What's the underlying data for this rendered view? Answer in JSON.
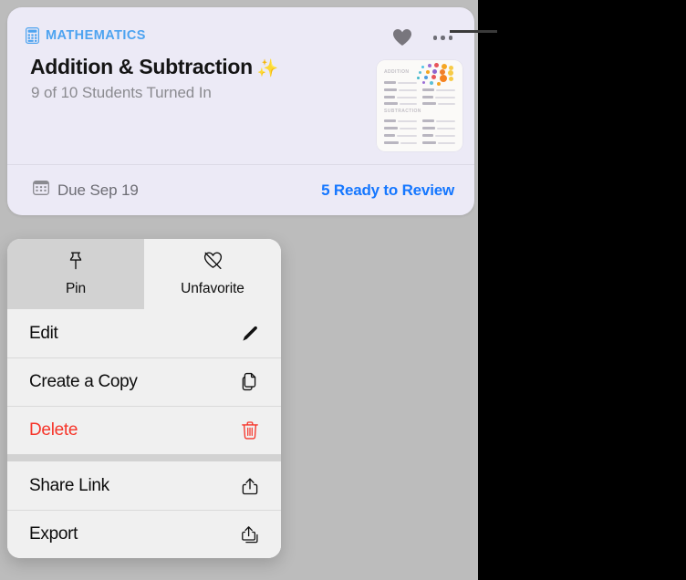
{
  "card": {
    "subject": "MATHEMATICS",
    "subject_icon": "calculator-icon",
    "title": "Addition & Subtraction",
    "title_emoji": "✨",
    "subtitle": "9 of 10 Students Turned In",
    "favorite_icon": "heart-filled-icon",
    "more_icon": "ellipsis-icon",
    "accent_color": "#4da3f0",
    "background_color": "#eceaf6",
    "footer": {
      "due_icon": "calendar-icon",
      "due_text": "Due Sep 19",
      "review_text": "5 Ready to Review",
      "review_color": "#1577ff"
    },
    "thumbnail": {
      "heading_1": "ADDITION",
      "heading_2": "SUBTRACTION"
    }
  },
  "menu": {
    "top_actions": [
      {
        "label": "Pin",
        "icon": "pin-icon",
        "selected": false
      },
      {
        "label": "Unfavorite",
        "icon": "heart-slash-icon",
        "selected": true
      }
    ],
    "groups": [
      {
        "items": [
          {
            "label": "Edit",
            "icon": "pencil-icon",
            "destructive": false
          },
          {
            "label": "Create a Copy",
            "icon": "duplicate-icon",
            "destructive": false
          },
          {
            "label": "Delete",
            "icon": "trash-icon",
            "destructive": true
          }
        ]
      },
      {
        "items": [
          {
            "label": "Share Link",
            "icon": "share-icon",
            "destructive": false
          },
          {
            "label": "Export",
            "icon": "export-icon",
            "destructive": false
          }
        ]
      }
    ],
    "danger_color": "#f6352a"
  }
}
